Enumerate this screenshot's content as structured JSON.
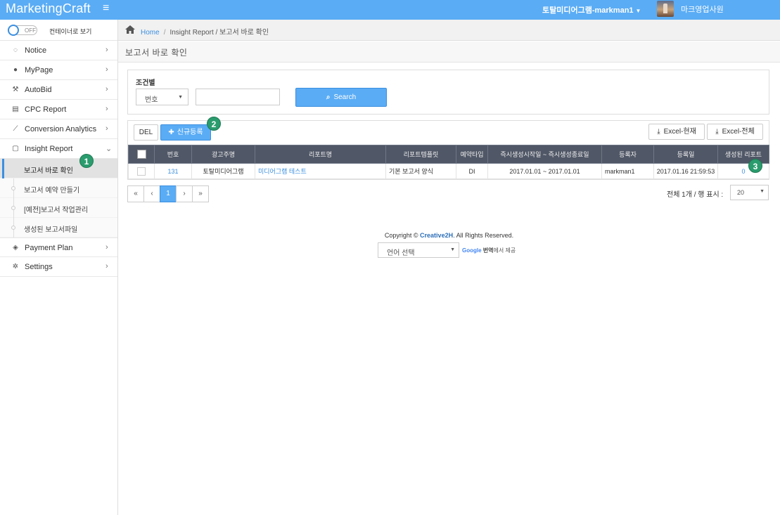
{
  "app": {
    "title": "MarketingCraft",
    "org": "토탈미디어그램-markman1",
    "user": "마크영업사원"
  },
  "sidebar": {
    "toggle_state": "OFF",
    "toggle_label": "컨테이너로 보기",
    "items": [
      {
        "label": "Notice",
        "icon": "comment-icon"
      },
      {
        "label": "MyPage",
        "icon": "user-icon"
      },
      {
        "label": "AutoBid",
        "icon": "gavel-icon"
      },
      {
        "label": "CPC Report",
        "icon": "book-icon"
      },
      {
        "label": "Conversion Analytics",
        "icon": "line-chart-icon"
      },
      {
        "label": "Insight Report",
        "icon": "document-icon"
      }
    ],
    "submenu": [
      {
        "label": "보고서 바로 확인",
        "active": true
      },
      {
        "label": "보고서 예약 만들기"
      },
      {
        "label": "[예전]보고서 작업관리"
      },
      {
        "label": "생성된 보고서파일"
      }
    ],
    "items_after": [
      {
        "label": "Payment Plan",
        "icon": "tag-icon"
      },
      {
        "label": "Settings",
        "icon": "gear-icon"
      }
    ]
  },
  "breadcrumb": {
    "home": "Home",
    "sep": "/",
    "path": "Insight Report / 보고서 바로 확인"
  },
  "page": {
    "title": "보고서 바로 확인"
  },
  "filter": {
    "label": "조건별",
    "select_value": "번호",
    "input_value": "",
    "search_label": "Search"
  },
  "toolbar": {
    "del_label": "DEL",
    "new_label": "신규등록",
    "excel_current": "Excel-현재",
    "excel_all": "Excel-전체"
  },
  "table": {
    "headers": [
      "",
      "번호",
      "광고주명",
      "리포트명",
      "리포트템플릿",
      "예약타입",
      "즉시생성시작일 ~ 즉시생성종료일",
      "등록자",
      "등록일",
      "생성된 리포트"
    ],
    "rows": [
      {
        "no": "131",
        "advertiser": "토탈미디어그램",
        "report": "미디어그램 테스트",
        "template": "기본 보고서 양식",
        "type": "DI",
        "period": "2017.01.01 ~ 2017.01.01",
        "registrant": "markman1",
        "date": "2017.01.16 21:59:53",
        "generated": "0"
      }
    ]
  },
  "pagination": {
    "first": "«",
    "prev": "‹",
    "current": "1",
    "next": "›",
    "last": "»",
    "total_text": "전체 1개 / 행 표시 :",
    "page_size": "20"
  },
  "footer": {
    "copyright_prefix": "Copyright ©",
    "company": "Creative2H",
    "copyright_suffix": ". All Rights Reserved.",
    "lang_select": "언어 선택",
    "google": "Google",
    "translate": "번역",
    "translate_suffix": "에서 제공"
  },
  "badges": [
    "1",
    "2",
    "3"
  ],
  "colors": {
    "accent": "#5aacf5",
    "table_header": "#505766",
    "badge": "#2a9c6d"
  }
}
